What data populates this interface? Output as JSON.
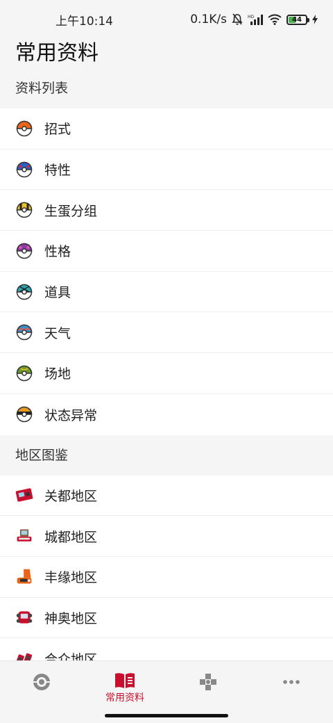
{
  "status_bar": {
    "time": "上午10:14",
    "speed": "0.1K/s",
    "battery": "44"
  },
  "page": {
    "title": "常用资料"
  },
  "sections": [
    {
      "header": "资料列表",
      "items": [
        {
          "label": "招式",
          "icon": "orange-pokeball-icon",
          "color": "#e8651a"
        },
        {
          "label": "特性",
          "icon": "great-ball-icon",
          "color": "#2f5fc6"
        },
        {
          "label": "生蛋分组",
          "icon": "ultra-ball-icon",
          "color": "#e8c22a"
        },
        {
          "label": "性格",
          "icon": "master-ball-icon",
          "color": "#8b3aa8"
        },
        {
          "label": "道具",
          "icon": "net-ball-icon",
          "color": "#2aa7b0"
        },
        {
          "label": "天气",
          "icon": "dive-ball-icon",
          "color": "#3d8fc9"
        },
        {
          "label": "场地",
          "icon": "friend-ball-icon",
          "color": "#6a9a2a"
        },
        {
          "label": "状态异常",
          "icon": "level-ball-icon",
          "color": "#e39a1f"
        }
      ]
    },
    {
      "header": "地区图鉴",
      "items": [
        {
          "label": "关都地区",
          "icon": "kanto-pokedex-icon"
        },
        {
          "label": "城都地区",
          "icon": "johto-pokedex-icon"
        },
        {
          "label": "丰缘地区",
          "icon": "hoenn-pokedex-icon"
        },
        {
          "label": "神奥地区",
          "icon": "sinnoh-pokedex-icon"
        },
        {
          "label": "合众地区",
          "icon": "unova-pokedex-icon"
        }
      ]
    }
  ],
  "bottom_nav": {
    "tabs": [
      {
        "label": "",
        "icon": "pokeball-icon"
      },
      {
        "label": "常用资料",
        "icon": "book-icon",
        "active": true
      },
      {
        "label": "",
        "icon": "gamepad-icon"
      },
      {
        "label": "",
        "icon": "more-icon"
      }
    ],
    "accent": "#c8102e"
  }
}
